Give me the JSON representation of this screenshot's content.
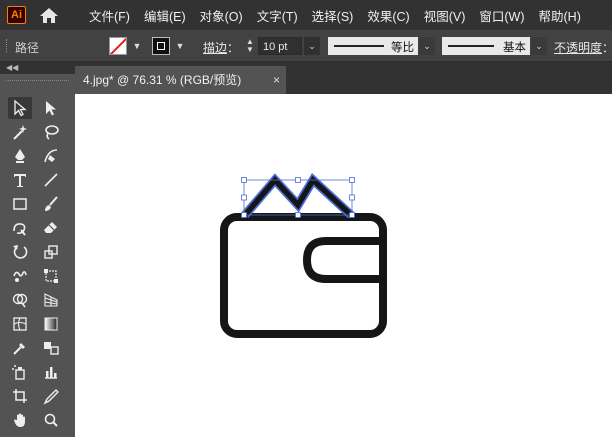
{
  "app": {
    "logo_text": "Ai",
    "home_icon": "home-icon"
  },
  "menu": [
    {
      "label": "文件(F)"
    },
    {
      "label": "编辑(E)"
    },
    {
      "label": "对象(O)"
    },
    {
      "label": "文字(T)"
    },
    {
      "label": "选择(S)"
    },
    {
      "label": "效果(C)"
    },
    {
      "label": "视图(V)"
    },
    {
      "label": "窗口(W)"
    },
    {
      "label": "帮助(H)"
    }
  ],
  "control_bar": {
    "selection_type": "路径",
    "fill_color": "none",
    "stroke_color": "#000000",
    "stroke_label": "描边",
    "stroke_colon": "：",
    "stroke_weight": "10 pt",
    "variable_width_profile": "等比",
    "brush_definition": "基本",
    "opacity_label": "不透明度",
    "opacity_colon": "："
  },
  "document": {
    "tab_title": "4.jpg* @ 76.31 % (RGB/预览)",
    "close_glyph": "×"
  },
  "tools": [
    {
      "name": "selection-tool-icon",
      "active": true
    },
    {
      "name": "direct-selection-tool-icon"
    },
    {
      "name": "magic-wand-tool-icon"
    },
    {
      "name": "lasso-tool-icon"
    },
    {
      "name": "pen-tool-icon"
    },
    {
      "name": "curvature-tool-icon"
    },
    {
      "name": "type-tool-icon"
    },
    {
      "name": "line-segment-tool-icon"
    },
    {
      "name": "rectangle-tool-icon"
    },
    {
      "name": "paintbrush-tool-icon"
    },
    {
      "name": "shaper-tool-icon"
    },
    {
      "name": "eraser-tool-icon"
    },
    {
      "name": "rotate-tool-icon"
    },
    {
      "name": "scale-tool-icon"
    },
    {
      "name": "warp-tool-icon"
    },
    {
      "name": "free-transform-tool-icon"
    },
    {
      "name": "shape-builder-tool-icon"
    },
    {
      "name": "perspective-grid-tool-icon"
    },
    {
      "name": "mesh-tool-icon"
    },
    {
      "name": "gradient-tool-icon"
    },
    {
      "name": "eyedropper-tool-icon"
    },
    {
      "name": "blend-tool-icon"
    },
    {
      "name": "symbol-sprayer-tool-icon"
    },
    {
      "name": "column-graph-tool-icon"
    },
    {
      "name": "artboard-tool-icon"
    },
    {
      "name": "slice-tool-icon"
    },
    {
      "name": "hand-tool-icon"
    },
    {
      "name": "zoom-tool-icon"
    }
  ],
  "colors": {
    "menubar_bg": "#323232",
    "control_bar_bg": "#424242",
    "panel_bg": "#535353",
    "selection_blue": "#4a6cd4",
    "artwork_stroke": "#161616",
    "logo_orange": "#ff7c00"
  }
}
